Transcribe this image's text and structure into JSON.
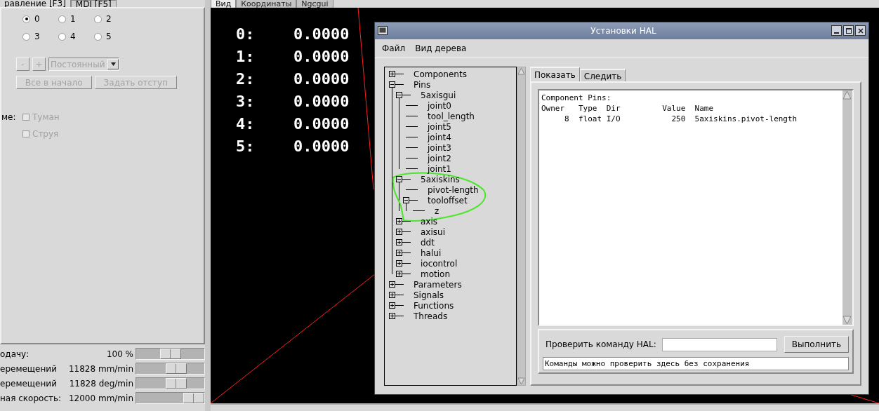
{
  "left_panel": {
    "tabs": [
      {
        "label": "равление [F3]",
        "selected": true
      },
      {
        "label": "MDI [F5]",
        "selected": false
      }
    ],
    "axis_radios": [
      {
        "label": "0",
        "selected": true
      },
      {
        "label": "1",
        "selected": false
      },
      {
        "label": "2",
        "selected": false
      },
      {
        "label": "3",
        "selected": false
      },
      {
        "label": "4",
        "selected": false
      },
      {
        "label": "5",
        "selected": false
      }
    ],
    "jog": {
      "minus": "-",
      "plus": "+",
      "mode": "Постоянный",
      "disabled": true
    },
    "buttons": [
      {
        "label": "Все в начало",
        "disabled": true
      },
      {
        "label": "Задать отступ",
        "disabled": true
      }
    ],
    "coolant": {
      "label": "ме:",
      "options": [
        {
          "label": "Туман",
          "checked": false,
          "disabled": true
        },
        {
          "label": "Струя",
          "checked": false,
          "disabled": true
        }
      ]
    },
    "sliders": [
      {
        "label": "одачу:",
        "reading": "100 %",
        "level": 0.5
      },
      {
        "label": "еремещений",
        "reading": "11828 mm/min",
        "level": 0.62
      },
      {
        "label": "еремещений",
        "reading": "11828 deg/min",
        "level": 0.62
      },
      {
        "label": "ная скорость:",
        "reading": "12000 mm/min",
        "level": 1
      }
    ]
  },
  "viewport": {
    "tabs": [
      {
        "label": "Вид",
        "selected": true
      },
      {
        "label": "Координаты",
        "selected": false
      },
      {
        "label": "Ngcgui",
        "selected": false
      }
    ],
    "dro": [
      {
        "axis": "0:",
        "value": "0.0000"
      },
      {
        "axis": "1:",
        "value": "0.0000"
      },
      {
        "axis": "2:",
        "value": "0.0000"
      },
      {
        "axis": "3:",
        "value": "0.0000"
      },
      {
        "axis": "4:",
        "value": "0.0000"
      },
      {
        "axis": "5:",
        "value": "0.0000"
      }
    ]
  },
  "hal_window": {
    "title": "Установки HAL",
    "menu": [
      "Файл",
      "Вид дерева"
    ],
    "tree": [
      {
        "label": "Components",
        "expanded": false
      },
      {
        "label": "Pins",
        "expanded": true,
        "children": [
          {
            "label": "5axisgui",
            "expanded": true,
            "children": [
              {
                "label": "joint0"
              },
              {
                "label": "tool_length"
              },
              {
                "label": "joint5"
              },
              {
                "label": "joint4"
              },
              {
                "label": "joint3"
              },
              {
                "label": "joint2"
              },
              {
                "label": "joint1"
              }
            ]
          },
          {
            "label": "5axiskins",
            "expanded": true,
            "children": [
              {
                "label": "pivot-length"
              },
              {
                "label": "tooloffset",
                "expanded": true,
                "children": [
                  {
                    "label": "z"
                  }
                ]
              }
            ]
          },
          {
            "label": "axis",
            "expanded": false
          },
          {
            "label": "axisui",
            "expanded": false
          },
          {
            "label": "ddt",
            "expanded": false
          },
          {
            "label": "halui",
            "expanded": false
          },
          {
            "label": "iocontrol",
            "expanded": false
          },
          {
            "label": "motion",
            "expanded": false
          }
        ]
      },
      {
        "label": "Parameters",
        "expanded": false
      },
      {
        "label": "Signals",
        "expanded": false
      },
      {
        "label": "Functions",
        "expanded": false
      },
      {
        "label": "Threads",
        "expanded": false
      }
    ],
    "tabs": [
      {
        "label": "Показать",
        "selected": true
      },
      {
        "label": "Следить",
        "selected": false
      }
    ],
    "output_lines": [
      "Component Pins:",
      "Owner   Type  Dir         Value  Name",
      "     8  float I/O           250  5axiskins.pivot-length"
    ],
    "command": {
      "label": "Проверить команду HAL:",
      "button": "Выполнить",
      "status": "Команды можно проверить здесь без сохранения"
    }
  }
}
